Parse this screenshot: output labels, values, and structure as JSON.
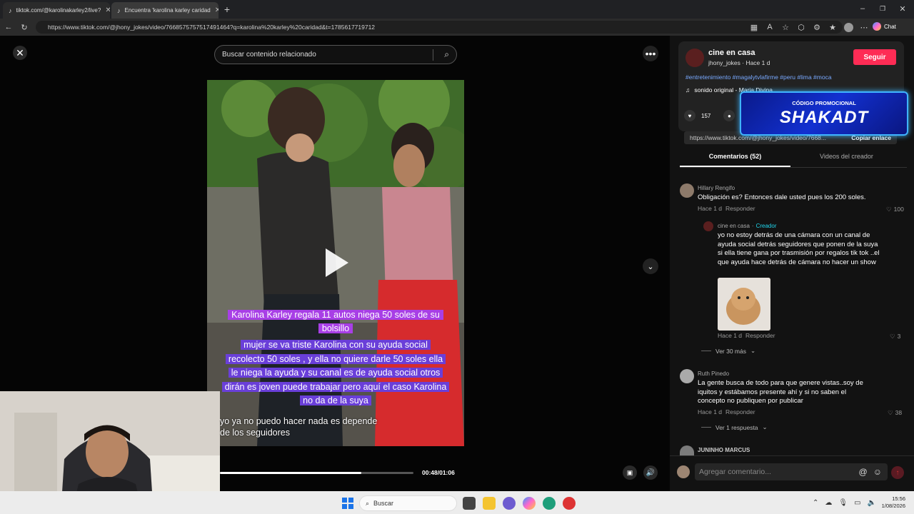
{
  "browser": {
    "tabs": [
      {
        "label": "tiktok.com/@karolinakarley2/live?"
      },
      {
        "label": "Encuentra 'karolina karley caridad"
      }
    ],
    "url": "https://www.tiktok.com/@jhony_jokes/video/7668575757517491464?q=karolina%20karley%20caridad&t=1785617719712",
    "chat_label": "Chat"
  },
  "video_pane": {
    "search_placeholder": "Buscar contenido relacionado",
    "caption_title_line1": "Karolina Karley regala 11 autos niega 50 soles de su",
    "caption_title_line2": "bolsillo",
    "caption_body": [
      "mujer se va triste Karolina con su ayuda social",
      "recolecto 50 soles , y ella no quiere darle 50 soles ella",
      "le niega la ayuda y su canal es de ayuda social otros",
      "dirán es joven puede trabajar pero aquí el caso Karolina",
      "no da de la suya"
    ],
    "subtitle_line1": "yo ya no puedo hacer nada es depende",
    "subtitle_line2": "de los seguidores",
    "time": "00:48/01:06",
    "progress_fraction": 0.73
  },
  "post": {
    "author": "cine en casa",
    "handle_time": "jhony_jokes · Hace 1 d",
    "follow_label": "Seguir",
    "hashtags": "#entretenimiento #magalytvlafirme #peru #lima #moca",
    "sound": "sonido original - Maria Divina",
    "likes": "157",
    "comments_count": "52",
    "link": "https://www.tiktok.com/@jhony_jokes/video/7668...",
    "copy_link": "Copiar enlace",
    "tab_comments": "Comentarios (52)",
    "tab_creator": "Videos del creador"
  },
  "promo": {
    "top": "CÓDIGO PROMOCIONAL",
    "code": "SHAKADT"
  },
  "comments": [
    {
      "name": "Hillary Rengifo",
      "text": "Obligación es? Entonces dale usted pues los 200 soles.",
      "time": "Hace 1 d",
      "reply": "Responder",
      "likes": "100"
    },
    {
      "name": "cine en casa",
      "creator": "Creador",
      "text": "yo no estoy detrás de una cámara con un canal de ayuda social detrás seguidores que ponen de la suya si ella tiene gana por trasmisión por regalos tik tok ..el que ayuda hace detrás de cámara no hacer un show",
      "time": "Hace 1 d",
      "reply": "Responder",
      "likes": "3"
    },
    {
      "name": "Ruth Pinedo",
      "text": "La gente busca de todo para que genere vistas..soy de iquitos y estábamos presente ahí y si no saben el concepto no publiquen por publicar",
      "time": "Hace 1 d",
      "reply": "Responder",
      "likes": "38"
    },
    {
      "name": "JUNINHO MARCUS"
    }
  ],
  "more_replies_1": "Ver 30 más",
  "more_replies_2": "Ver 1 respuesta",
  "add_comment_placeholder": "Agregar comentario...",
  "taskbar": {
    "search": "Buscar",
    "time": "15:56",
    "date": "1/08/2026"
  },
  "colors": {
    "follow": "#fe2c55",
    "creator": "#20d5ec",
    "caption_title": "#a83fe6",
    "caption_body": "#6a3fd9"
  }
}
